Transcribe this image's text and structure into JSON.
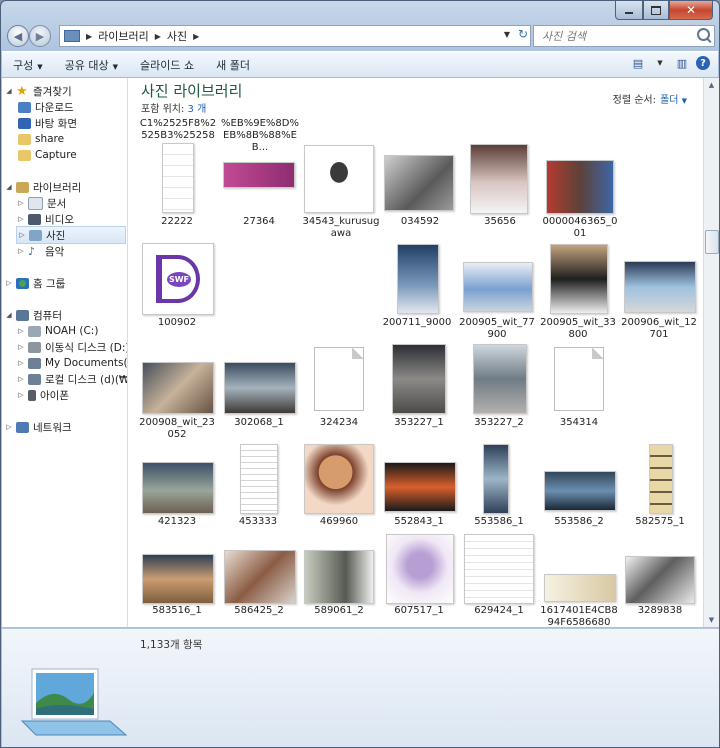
{
  "window": {
    "minimize_symbol": "–",
    "close_symbol": "✕"
  },
  "address": {
    "crumbs": [
      "라이브러리",
      "사진"
    ],
    "search_placeholder": "사진 검색"
  },
  "toolbar": {
    "organize": "구성",
    "share": "공유 대상",
    "slideshow": "슬라이드 쇼",
    "new_folder": "새 폴더"
  },
  "nav": {
    "favorites": "즐겨찾기",
    "downloads": "다운로드",
    "desktop": "바탕 화면",
    "share": "share",
    "capture": "Capture",
    "libraries": "라이브러리",
    "documents": "문서",
    "videos": "비디오",
    "pictures": "사진",
    "music": "음악",
    "homegroup": "홈 그룹",
    "computer": "컴퓨터",
    "noah": "NOAH (C:)",
    "removable": "이동식 디스크 (D:)",
    "mydocs": "My Documents(₩₩",
    "localdisk": "로컬 디스크 (d)(₩₩",
    "ipod": "아이폰",
    "network": "네트워크"
  },
  "library": {
    "title": "사진 라이브러리",
    "includes_label": "포함 위치:",
    "includes_value": "3 개",
    "sort_label": "정렬 순서:",
    "sort_value": "폴더"
  },
  "files": {
    "top1": "C1%2525F8%2525B3%252582...",
    "top2": "%EB%9E%8D%EB%8B%88%EB...",
    "r1": [
      "22222",
      "27364",
      "34543_kurusugawa",
      "034592",
      "35656",
      "0000046365_001"
    ],
    "r2": [
      "100902",
      "200711_9000",
      "200905_wit_77900",
      "200905_wit_33800",
      "200906_wit_12701"
    ],
    "r3": [
      "200908_wit_23052",
      "302068_1",
      "324234",
      "353227_1",
      "353227_2",
      "354314"
    ],
    "r4": [
      "421323",
      "453333",
      "469960",
      "552843_1",
      "553586_1",
      "553586_2",
      "582575_1"
    ],
    "r5": [
      "583516_1",
      "586425_2",
      "589061_2",
      "607517_1",
      "629424_1",
      "1617401E4CB894F6586680",
      "3289838"
    ],
    "swf_text": "SWF"
  },
  "status": {
    "count": "1,133개 항목"
  }
}
